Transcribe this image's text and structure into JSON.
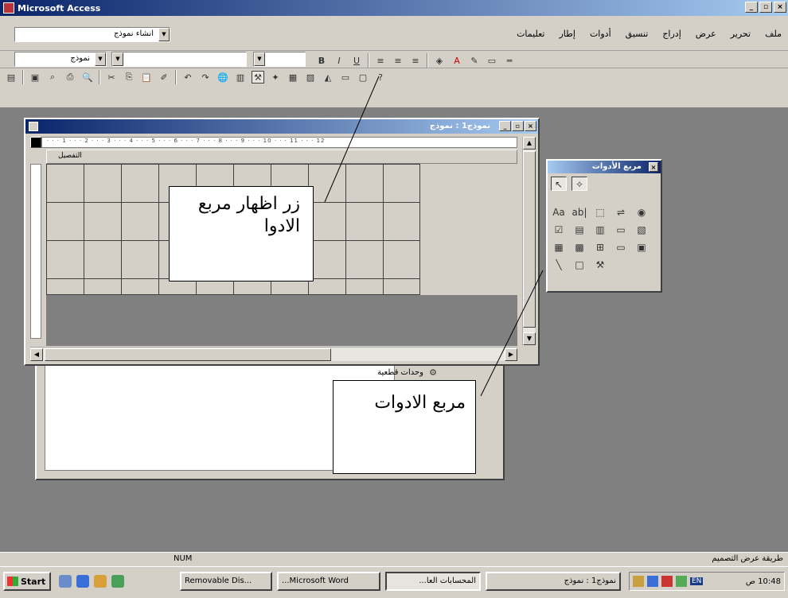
{
  "app": {
    "title": "Microsoft Access"
  },
  "menubar": {
    "create_form_label": "انشاء نموذج",
    "items": [
      "ملف",
      "تحرير",
      "عرض",
      "إدراج",
      "تنسيق",
      "أدوات",
      "إطار",
      "تعليمات"
    ]
  },
  "formatbar": {
    "object_combo": "نموذج"
  },
  "form_window": {
    "title": "نموذج1 : نموذج",
    "section_label": "التفصيل",
    "ruler": "· · · 1 · · · 2 · · · 3 · · · 4 · · · 5 · · · 6 · · · 7 · · · 8 · · · 9 · · · 10 · · · 11 · · · 12"
  },
  "db_window": {
    "item_label": "وحدات قطعية"
  },
  "toolbox": {
    "title": "مربع الأدوات"
  },
  "callouts": {
    "toolbox_button": "زر اظهار مربع الادوا",
    "toolbox_box": "مربع الادوات"
  },
  "statusbar": {
    "num": "NUM",
    "mode": "طريقة عرض التصميم"
  },
  "taskbar": {
    "start": "Start",
    "tasks": [
      "Removable Dis...",
      "...Microsoft Word",
      "المحسابات العا...",
      "نموذج1 : نموذج"
    ],
    "lang": "EN",
    "clock": "10:48 ص"
  }
}
